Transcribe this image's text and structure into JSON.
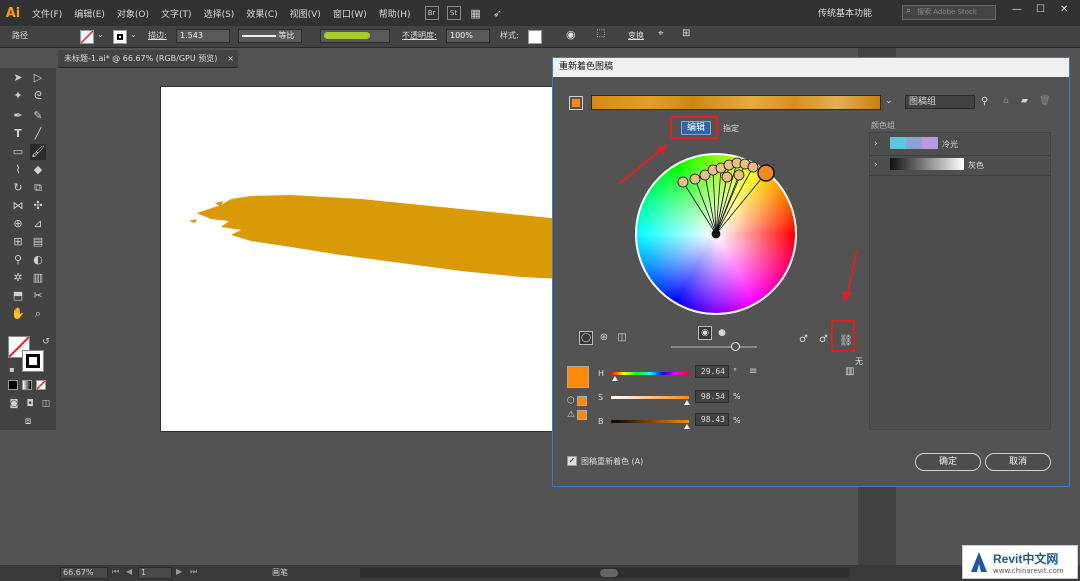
{
  "app": {
    "logo": "Ai",
    "menu": [
      "文件(F)",
      "编辑(E)",
      "对象(O)",
      "文字(T)",
      "选择(S)",
      "效果(C)",
      "视图(V)",
      "窗口(W)",
      "帮助(H)"
    ],
    "bridge_icon": "Br",
    "stock_icon": "St",
    "workspace": "传统基本功能",
    "stock_search_placeholder": "搜索 Adobe Stock",
    "window_controls": [
      "—",
      "☐",
      "✕"
    ]
  },
  "controlbar": {
    "path_label": "路径",
    "stroke_label": "描边:",
    "stroke_value": "1.543",
    "stroke_profile": "等比",
    "opacity_label": "不透明度:",
    "opacity_value": "100%",
    "style_label": "样式:",
    "transform_label": "变换"
  },
  "document": {
    "tab_title": "未标题-1.ai* @ 66.67% (RGB/GPU 预览)",
    "paint_color": "#d99a05"
  },
  "statusbar": {
    "zoom": "66.67%",
    "page": "1",
    "tool": "画笔"
  },
  "dialog": {
    "title": "重新着色图稿",
    "group_name": "图稿组",
    "tab_edit": "编辑",
    "tab_assign": "指定",
    "color_groups_header": "颜色组",
    "color_groups": [
      {
        "name": "冷光",
        "colors": [
          "#5ac8d8",
          "#8fa0d8",
          "#b79bd8"
        ]
      },
      {
        "name": "灰色",
        "colors": [
          "#111111",
          "#333333",
          "#555555",
          "#777777",
          "#999999",
          "#bbbbbb",
          "#dddddd",
          "#ffffff"
        ]
      }
    ],
    "none_label": "无",
    "active_color": "#ff8a0a",
    "h_label": "H",
    "h_value": "29.64",
    "h_unit": "°",
    "s_label": "S",
    "s_value": "98.54",
    "s_unit": "%",
    "b_label": "B",
    "b_value": "98.43",
    "b_unit": "%",
    "recolor_checkbox_label": "图稿重新着色 (A)",
    "ok_label": "确定",
    "cancel_label": "取消"
  },
  "watermark": {
    "brand": "Revit中文网",
    "url": "www.chinarevit.com"
  }
}
